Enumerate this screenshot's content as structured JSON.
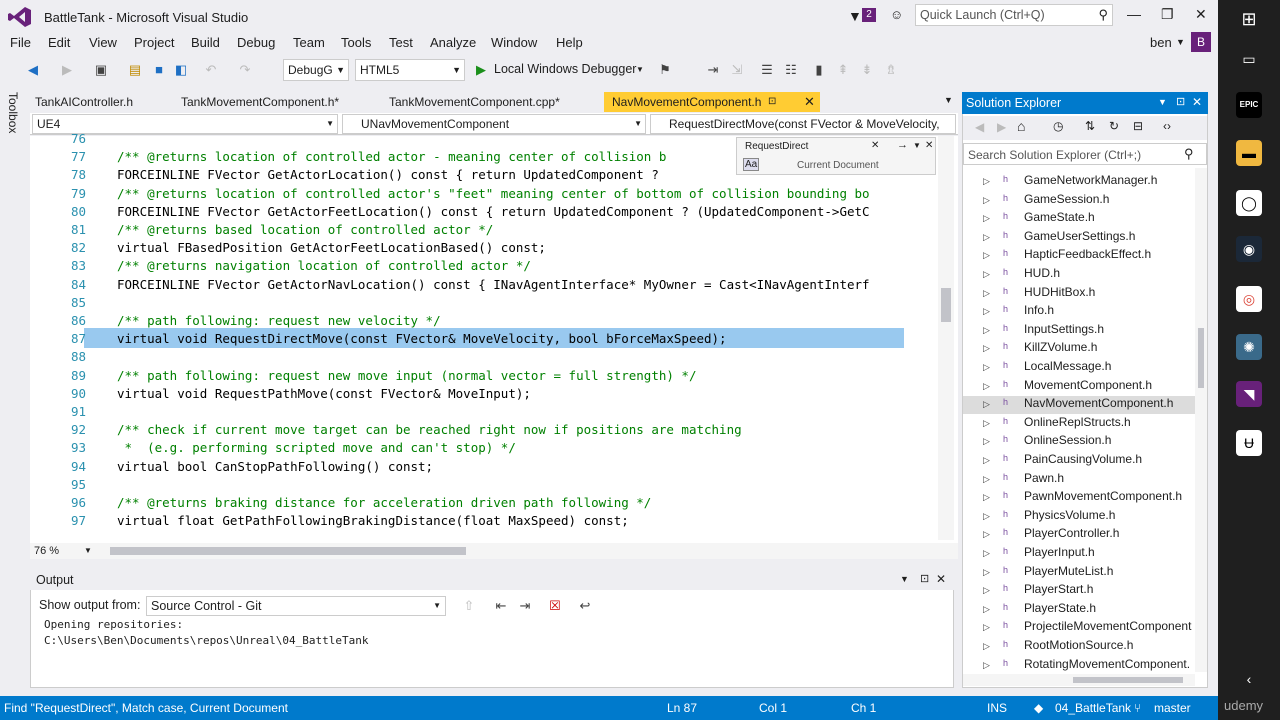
{
  "title": {
    "app": "BattleTank - Microsoft Visual Studio",
    "notif_count": "2",
    "quick_launch": "Quick Launch (Ctrl+Q)"
  },
  "menu": [
    "File",
    "Edit",
    "View",
    "Project",
    "Build",
    "Debug",
    "Team",
    "Tools",
    "Test",
    "Analyze",
    "Window",
    "Help"
  ],
  "user": {
    "name": "ben",
    "initial": "B"
  },
  "toolbar": {
    "config": "DebugG",
    "platform": "HTML5",
    "debugger": "Local Windows Debugger"
  },
  "toolbox_label": "Toolbox",
  "tabs": [
    {
      "label": "TankAIController.h"
    },
    {
      "label": "TankMovementComponent.h*"
    },
    {
      "label": "TankMovementComponent.cpp*"
    },
    {
      "label": "NavMovementComponent.h"
    }
  ],
  "nav": {
    "project": "UE4",
    "scope": "UNavMovementComponent",
    "member": "RequestDirectMove(const FVector & MoveVelocity,"
  },
  "find": {
    "query": "RequestDirect",
    "scope": "Current Document",
    "match_case": "Aa"
  },
  "code_lines": [
    {
      "n": "76",
      "t": ""
    },
    {
      "n": "77",
      "t": "/** @returns location of controlled actor - meaning center of collision b"
    },
    {
      "n": "78",
      "t": "FORCEINLINE FVector GetActorLocation() const { return UpdatedComponent ?"
    },
    {
      "n": "79",
      "t": "/** @returns location of controlled actor's \"feet\" meaning center of bottom of collision bounding bo"
    },
    {
      "n": "80",
      "t": "FORCEINLINE FVector GetActorFeetLocation() const { return UpdatedComponent ? (UpdatedComponent->GetC"
    },
    {
      "n": "81",
      "t": "/** @returns based location of controlled actor */"
    },
    {
      "n": "82",
      "t": "virtual FBasedPosition GetActorFeetLocationBased() const;"
    },
    {
      "n": "83",
      "t": "/** @returns navigation location of controlled actor */"
    },
    {
      "n": "84",
      "t": "FORCEINLINE FVector GetActorNavLocation() const { INavAgentInterface* MyOwner = Cast<INavAgentInterf"
    },
    {
      "n": "85",
      "t": ""
    },
    {
      "n": "86",
      "t": "/** path following: request new velocity */"
    },
    {
      "n": "87",
      "t": "virtual void RequestDirectMove(const FVector& MoveVelocity, bool bForceMaxSpeed);"
    },
    {
      "n": "88",
      "t": ""
    },
    {
      "n": "89",
      "t": "/** path following: request new move input (normal vector = full strength) */"
    },
    {
      "n": "90",
      "t": "virtual void RequestPathMove(const FVector& MoveInput);"
    },
    {
      "n": "91",
      "t": ""
    },
    {
      "n": "92",
      "t": "/** check if current move target can be reached right now if positions are matching"
    },
    {
      "n": "93",
      "t": " *  (e.g. performing scripted move and can't stop) */"
    },
    {
      "n": "94",
      "t": "virtual bool CanStopPathFollowing() const;"
    },
    {
      "n": "95",
      "t": ""
    },
    {
      "n": "96",
      "t": "/** @returns braking distance for acceleration driven path following */"
    },
    {
      "n": "97",
      "t": "virtual float GetPathFollowingBrakingDistance(float MaxSpeed) const;"
    }
  ],
  "zoom": "76 %",
  "output": {
    "title": "Output",
    "show_from_label": "Show output from:",
    "source": "Source Control - Git",
    "lines": [
      "Opening repositories:",
      "C:\\Users\\Ben\\Documents\\repos\\Unreal\\04_BattleTank"
    ]
  },
  "solution_explorer": {
    "title": "Solution Explorer",
    "search_placeholder": "Search Solution Explorer (Ctrl+;)",
    "items": [
      "GameNetworkManager.h",
      "GameSession.h",
      "GameState.h",
      "GameUserSettings.h",
      "HapticFeedbackEffect.h",
      "HUD.h",
      "HUDHitBox.h",
      "Info.h",
      "InputSettings.h",
      "KillZVolume.h",
      "LocalMessage.h",
      "MovementComponent.h",
      "NavMovementComponent.h",
      "OnlineReplStructs.h",
      "OnlineSession.h",
      "PainCausingVolume.h",
      "Pawn.h",
      "PawnMovementComponent.h",
      "PhysicsVolume.h",
      "PlayerController.h",
      "PlayerInput.h",
      "PlayerMuteList.h",
      "PlayerStart.h",
      "PlayerState.h",
      "ProjectileMovementComponent",
      "RootMotionSource.h",
      "RotatingMovementComponent."
    ],
    "selected": "NavMovementComponent.h"
  },
  "status": {
    "message": "Find \"RequestDirect\", Match case, Current Document",
    "ln": "Ln 87",
    "col": "Col 1",
    "ch": "Ch 1",
    "ins": "INS",
    "repo": "04_BattleTank",
    "branch": "master"
  },
  "watermark": "udemy",
  "colors": {
    "accent": "#007acc",
    "active_tab": "#ffcc33",
    "selection": "#99c9ef",
    "comment": "#008000",
    "keyword": "#0000ff",
    "type": "#2b91af"
  }
}
